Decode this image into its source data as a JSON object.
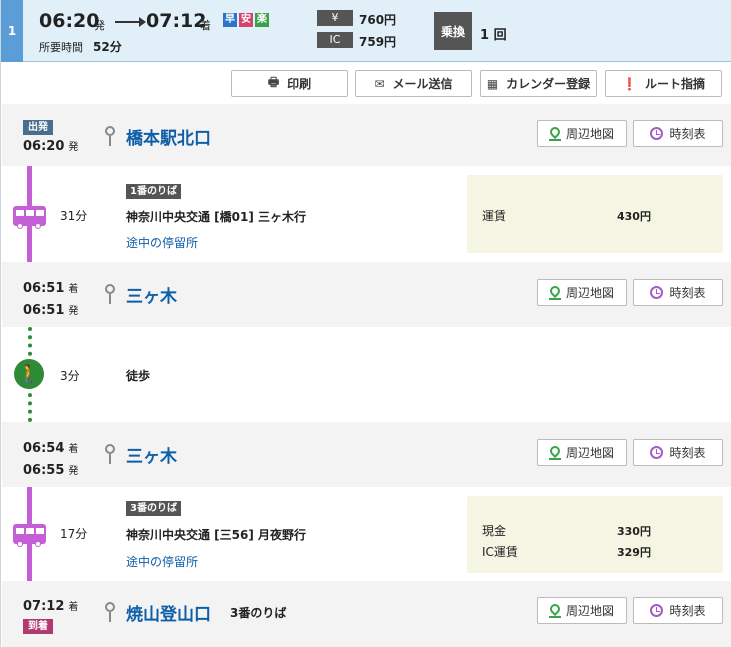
{
  "route": {
    "index": "1",
    "depart_time": "06:20",
    "depart_suffix": "発",
    "arrive_time": "07:12",
    "arrive_suffix": "着",
    "badges": [
      {
        "label": "早",
        "color": "#2b74c9"
      },
      {
        "label": "安",
        "color": "#d54470"
      },
      {
        "label": "楽",
        "color": "#3aa34a"
      }
    ],
    "duration_label": "所要時間",
    "duration_value": "52分",
    "fares": [
      {
        "tag": "¥",
        "value": "760円"
      },
      {
        "tag": "IC",
        "value": "759円"
      }
    ],
    "transfer_label": "乗換",
    "transfer_value": "1 回"
  },
  "toolbar": {
    "print": "印刷",
    "email": "メール送信",
    "calendar": "カレンダー登録",
    "guide": "ルート指摘"
  },
  "buttons": {
    "map": "周辺地図",
    "timetable": "時刻表"
  },
  "stops": [
    {
      "tag": "出発",
      "times": [
        {
          "time": "06:20",
          "suffix": "発"
        }
      ],
      "name": "橋本駅北口",
      "platform": ""
    },
    {
      "tag": "",
      "times": [
        {
          "time": "06:51",
          "suffix": "着"
        },
        {
          "time": "06:51",
          "suffix": "発"
        }
      ],
      "name": "三ヶ木",
      "platform": ""
    },
    {
      "tag": "",
      "times": [
        {
          "time": "06:54",
          "suffix": "着"
        },
        {
          "time": "06:55",
          "suffix": "発"
        }
      ],
      "name": "三ヶ木",
      "platform": ""
    },
    {
      "tag": "到着",
      "times": [
        {
          "time": "07:12",
          "suffix": "着"
        }
      ],
      "name": "焼山登山口",
      "platform": "3番のりば"
    }
  ],
  "segments": [
    {
      "mode": "bus",
      "minutes": "31分",
      "platform": "1番のりば",
      "line": "神奈川中央交通 [橋01] 三ヶ木行",
      "stops_link": "途中の停留所",
      "fares": [
        {
          "label": "運賃",
          "value": "430円"
        }
      ]
    },
    {
      "mode": "walk",
      "minutes": "3分",
      "label": "徒歩"
    },
    {
      "mode": "bus",
      "minutes": "17分",
      "platform": "3番のりば",
      "line": "神奈川中央交通 [三56] 月夜野行",
      "stops_link": "途中の停留所",
      "fares": [
        {
          "label": "現金",
          "value": "330円"
        },
        {
          "label": "IC運賃",
          "value": "329円"
        }
      ]
    }
  ]
}
